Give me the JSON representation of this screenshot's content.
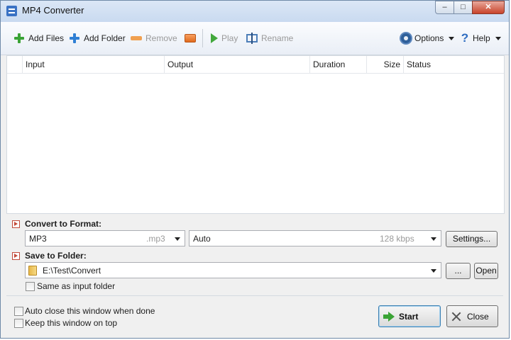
{
  "window": {
    "title": "MP4 Converter"
  },
  "toolbar": {
    "add_files": "Add Files",
    "add_folder": "Add Folder",
    "remove": "Remove",
    "play": "Play",
    "rename": "Rename",
    "options": "Options",
    "help": "Help"
  },
  "list": {
    "columns": [
      "Input",
      "Output",
      "Duration",
      "Size",
      "Status"
    ],
    "rows": []
  },
  "convert": {
    "label": "Convert to Format:",
    "format": "MP3",
    "format_ext": ".mp3",
    "quality": "Auto",
    "quality_hint": "128 kbps",
    "settings_button": "Settings..."
  },
  "save": {
    "label": "Save to Folder:",
    "folder": "E:\\Test\\Convert",
    "browse_button": "...",
    "open_button": "Open",
    "same_as_input": "Same as input folder"
  },
  "footer": {
    "auto_close": "Auto close this window when done",
    "keep_on_top": "Keep this window on top",
    "start_button": "Start",
    "close_button": "Close"
  }
}
